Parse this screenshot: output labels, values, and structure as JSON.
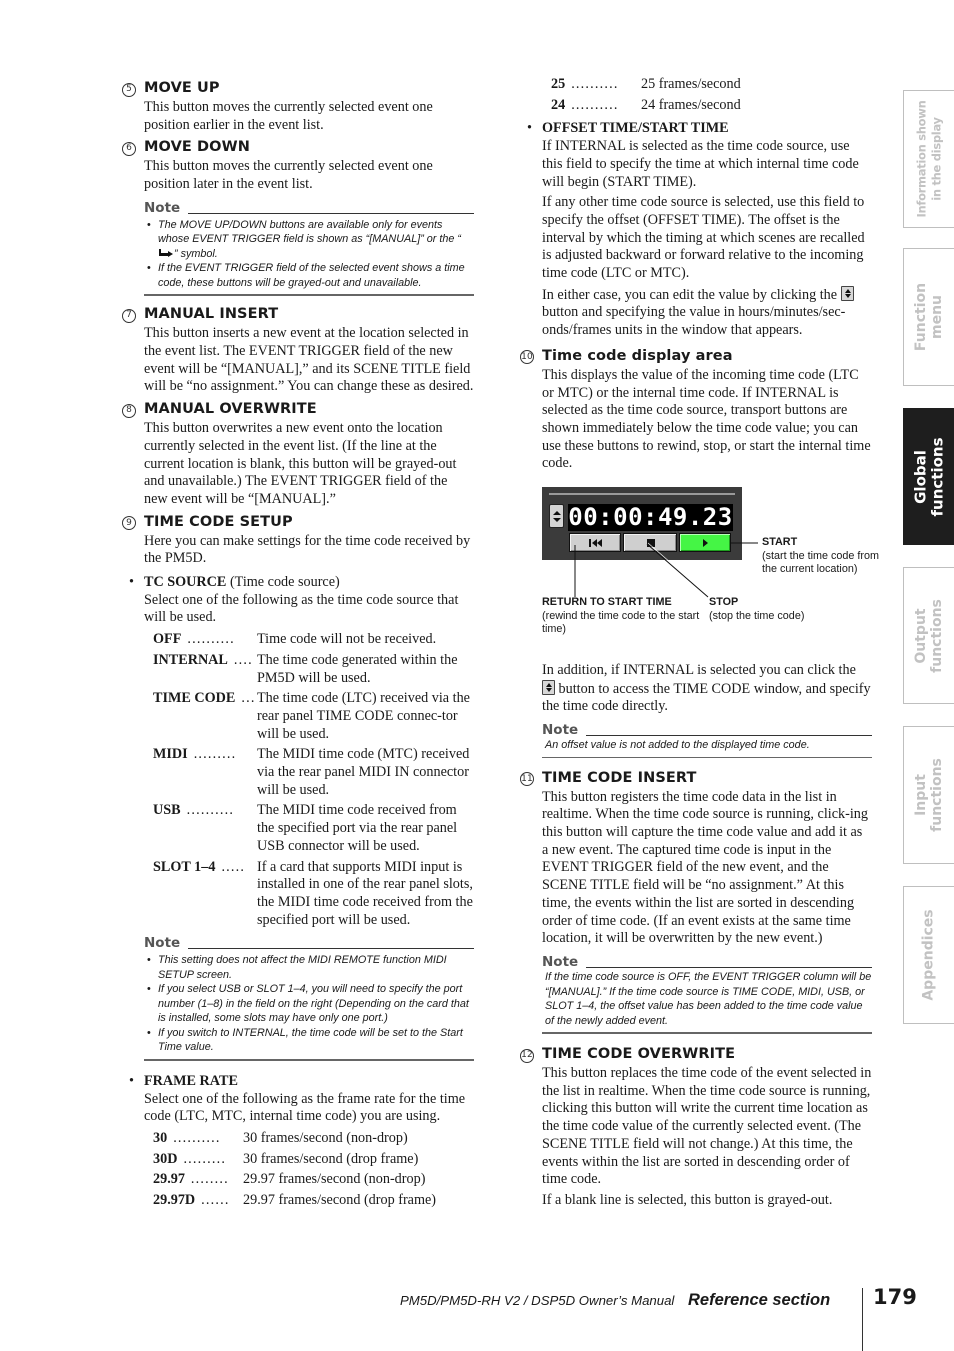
{
  "left_column": {
    "move_up": {
      "number": "5",
      "title": "MOVE UP",
      "body": "This button moves the currently selected event one position earlier in the event list."
    },
    "move_down": {
      "number": "6",
      "title": "MOVE DOWN",
      "body": "This button moves the currently selected event one position later in the event list."
    },
    "note1": {
      "label": "Note",
      "items": [
        {
          "before": "The MOVE UP/DOWN buttons are available only for events whose EVENT TRIGGER field is shown as “[MANUAL]” or the “",
          "icon": "manual-arrow-symbol-icon",
          "after": "” symbol."
        },
        {
          "text": "If the EVENT TRIGGER field of the selected event shows a time code, these buttons will be grayed-out and unavailable."
        }
      ]
    },
    "manual_insert": {
      "number": "7",
      "title": "MANUAL INSERT",
      "body": "This button inserts a new event at the location selected in the event list. The EVENT TRIGGER field of the new event will be “[MANUAL],” and its SCENE TITLE field will be “no assignment.” You can change these as desired."
    },
    "manual_overwrite": {
      "number": "8",
      "title": "MANUAL OVERWRITE",
      "body": "This button overwrites a new event onto the location currently selected in the event list. (If the line at the current location is blank, this button will be grayed-out and unavailable.) The EVENT TRIGGER field of the new event will be “[MANUAL].”"
    },
    "time_code_setup": {
      "number": "9",
      "title": "TIME CODE SETUP",
      "body": "Here you can make settings for the time code received by the PM5D."
    },
    "tc_source": {
      "title": "TC SOURCE",
      "title_suffix": "(Time code source)",
      "body": "Select one of the following as the time code source that will be used.",
      "options": [
        {
          "term": "OFF",
          "dots": "..........",
          "desc": "Time code will not be received."
        },
        {
          "term": "INTERNAL",
          "dots": "....",
          "desc": "The time code generated within the PM5D will be used."
        },
        {
          "term": "TIME CODE",
          "dots": "...",
          "desc": "The time code (LTC) received via the rear panel TIME CODE connec-tor will be used."
        },
        {
          "term": "MIDI",
          "dots": ".........",
          "desc": "The MIDI time code (MTC) received via the rear panel MIDI IN connector will be used."
        },
        {
          "term": "USB",
          "dots": "..........",
          "desc": "The MIDI time code received from the specified port via the rear panel USB connector will be used."
        },
        {
          "term": "SLOT 1–4",
          "dots": ".....",
          "desc": "If a card that supports MIDI input is installed in one of the rear panel slots, the MIDI time code received from the specified port will be used."
        }
      ]
    },
    "note2": {
      "label": "Note",
      "items": [
        "This setting does not affect the MIDI REMOTE function MIDI SETUP screen.",
        "If you select USB or SLOT 1–4, you will need to specify the port number (1–8) in the field on the right (Depending on the card that is installed, some slots may have only one port.)",
        "If you switch to INTERNAL, the time code will be set to the Start Time value."
      ]
    },
    "frame_rate": {
      "title": "FRAME RATE",
      "body": "Select one of the following as the frame rate for the time code (LTC, MTC, internal time code) you are using.",
      "options": [
        {
          "term": "30",
          "dots": "..........",
          "desc": "30 frames/second (non-drop)"
        },
        {
          "term": "30D",
          "dots": ".........",
          "desc": "30 frames/second (drop frame)"
        },
        {
          "term": "29.97",
          "dots": "........",
          "desc": "29.97 frames/second (non-drop)"
        },
        {
          "term": "29.97D",
          "dots": "......",
          "desc": "29.97 frames/second (drop frame)"
        }
      ]
    }
  },
  "right_column": {
    "frame_rate_cont": [
      {
        "term": "25",
        "dots": "..........",
        "desc": "25 frames/second"
      },
      {
        "term": "24",
        "dots": "..........",
        "desc": "24 frames/second"
      }
    ],
    "offset_time": {
      "title": "OFFSET TIME/START TIME",
      "p1": "If INTERNAL is selected as the time code source, use this field to specify the time at which internal time code will begin (START TIME).",
      "p2": "If any other time code source is selected, use this field to specify the offset (OFFSET TIME). The offset is the interval by which the timing at which scenes are recalled is adjusted backward or forward relative to the incoming time code (LTC or MTC).",
      "p3_before": "In either case, you can edit the value by clicking the",
      "p3_after": "button and specifying the value in hours/minutes/sec-onds/frames units in the window that appears."
    },
    "time_code_display": {
      "number": "10",
      "title": "Time code display area",
      "body": "This displays the value of the incoming time code (LTC or MTC) or the internal time code. If INTERNAL is selected as the time code source, transport buttons are shown immediately below the time code value; you can use these buttons to rewind, stop, or start the internal time code."
    },
    "tc_figure": {
      "timecode": "00:00:49.23",
      "start_color": "#45f545",
      "callouts": {
        "start_title": "START",
        "start_desc": "(start the time code from the current location)",
        "return_title": "RETURN TO START TIME",
        "return_desc": "(rewind the time code to the start time)",
        "stop_title": "STOP",
        "stop_desc": "(stop the time code)"
      }
    },
    "addition": {
      "before": "In addition, if INTERNAL is selected you can click the",
      "after": "button to access the TIME CODE window, and specify the time code directly."
    },
    "note3": {
      "label": "Note",
      "text": "An offset value is not added to the displayed time code."
    },
    "time_code_insert": {
      "number": "11",
      "title": "TIME CODE INSERT",
      "body": "This button registers the time code data in the list in realtime. When the time code source is running, click-ing this button will capture the time code value and add it as a new event. The captured time code is input in the EVENT TRIGGER field of the new event, and the SCENE TITLE field will be “no assignment.” At this time, the events within the list are sorted in descending order of time code. (If an event exists at the same time location, it will be overwritten by the new event.)"
    },
    "note4": {
      "label": "Note",
      "text": "If the time code source is OFF, the EVENT TRIGGER column will be “[MANUAL].” If the time code source is TIME CODE, MIDI, USB, or SLOT 1–4, the offset value has been added to the time code value of the newly added event."
    },
    "time_code_overwrite": {
      "number": "12",
      "title": "TIME CODE OVERWRITE",
      "body": "This button replaces the time code of the event selected in the list in realtime. When the time code source is running, clicking this button will write the current time location as the time code value of the currently selected event. (The SCENE TITLE field will not change.) At this time, the events within the list are sorted in descending order of time code.",
      "body2": "If a blank line is selected, this button is grayed-out."
    }
  },
  "side_tabs": [
    {
      "line1": "Information shown",
      "line2": "in the display",
      "active": false
    },
    {
      "line1": "Function",
      "line2": "menu",
      "active": false
    },
    {
      "line1": "Global",
      "line2": "functions",
      "active": true
    },
    {
      "line1": "Output",
      "line2": "functions",
      "active": false
    },
    {
      "line1": "Input",
      "line2": "functions",
      "active": false
    },
    {
      "line1": "Appendices",
      "line2": "",
      "active": false
    }
  ],
  "footer": {
    "manual_title": "PM5D/PM5D-RH V2 / DSP5D Owner’s Manual",
    "section": "Reference section",
    "page_number": "179"
  }
}
